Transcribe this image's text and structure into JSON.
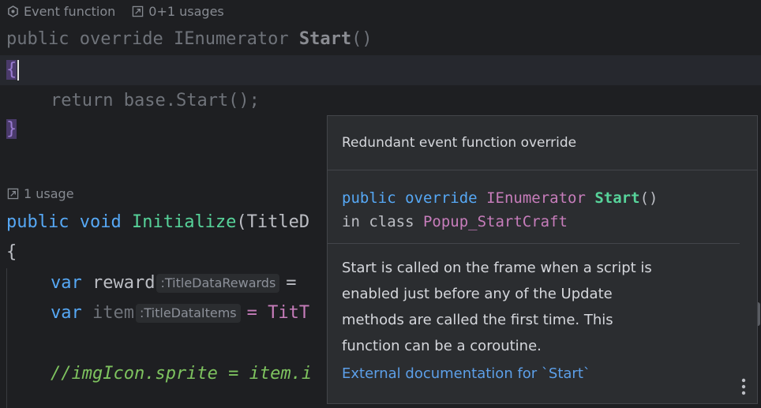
{
  "hints": {
    "event_function": "Event function",
    "usages_1": "0+1 usages",
    "usage_2": "1 usage"
  },
  "code": {
    "l1_public": "public",
    "l1_override": "override",
    "l1_type": "IEnumerator",
    "l1_name": "Start",
    "l1_parens": "()",
    "l2_open": "{",
    "l3_return": "return",
    "l3_expr": "base.Start();",
    "l4_close": "}",
    "l5_public": "public",
    "l5_void": "void",
    "l5_name": "Initialize",
    "l5_param_start": "(TitleD",
    "l6_open": "{",
    "l7_var": "var",
    "l7_name": "reward",
    "l7_hint": ":TitleDataRewards",
    "l7_eq": "=",
    "l8_var": "var",
    "l8_name": "item",
    "l8_hint": ":TitleDataItems",
    "l8_eq": "= TitT",
    "l9_comment": "//imgIcon.sprite = item.i"
  },
  "popup": {
    "title": "Redundant event function override",
    "sig_public": "public",
    "sig_override": "override",
    "sig_type": "IEnumerator",
    "sig_name": "Start",
    "sig_parens": "()",
    "sig_in": "in class",
    "sig_class": "Popup_StartCraft",
    "desc_1": "Start is called on the frame when a script is",
    "desc_2": "enabled just before any of the Update",
    "desc_3": "methods are called the first time. This",
    "desc_4": "function can be a coroutine.",
    "link": "External documentation for `Start`"
  },
  "colors": {
    "background": "#1e1f22",
    "popup_bg": "#2b2d30",
    "keyword": "#56a8f5",
    "type": "#c77dbb",
    "method": "#57d39a",
    "comment": "#7ec35f",
    "link": "#5c9fe8"
  },
  "icons": {
    "unity": "unity-icon",
    "usages": "external-link-icon",
    "more": "more-vertical-icon"
  }
}
